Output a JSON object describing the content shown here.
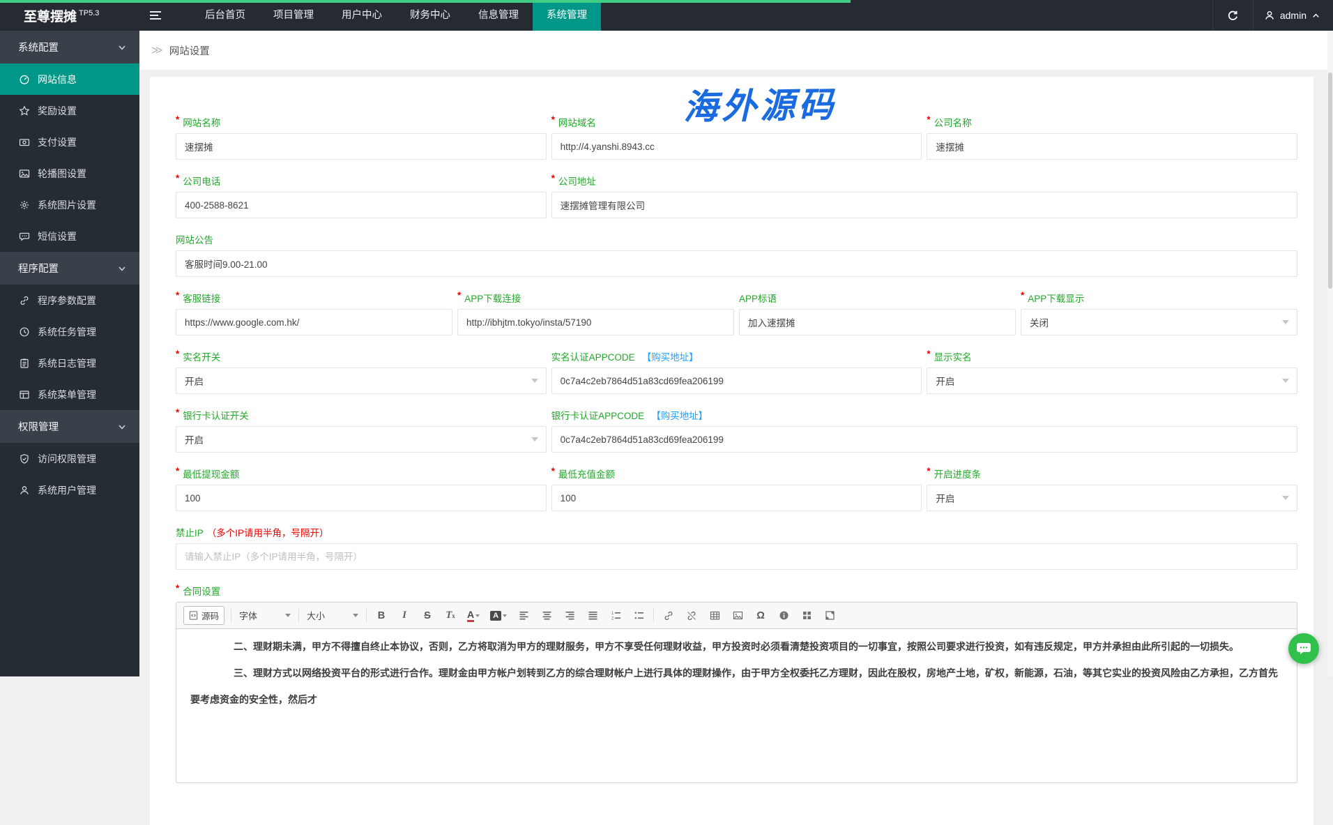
{
  "navbar": {
    "logo": "至尊摆摊",
    "logo_badge": "TP5.3",
    "items": [
      {
        "label": "后台首页"
      },
      {
        "label": "项目管理"
      },
      {
        "label": "用户中心"
      },
      {
        "label": "财务中心"
      },
      {
        "label": "信息管理"
      },
      {
        "label": "系统管理",
        "active": true
      }
    ],
    "user": "admin"
  },
  "sidebar": {
    "groups": [
      {
        "header": "系统配置",
        "items": [
          {
            "label": "网站信息",
            "icon": "dashboard-icon",
            "active": true
          },
          {
            "label": "奖励设置",
            "icon": "star-icon"
          },
          {
            "label": "支付设置",
            "icon": "money-icon"
          },
          {
            "label": "轮播图设置",
            "icon": "carousel-image-icon"
          },
          {
            "label": "系统图片设置",
            "icon": "gear-icon"
          },
          {
            "label": "短信设置",
            "icon": "sms-icon"
          }
        ]
      },
      {
        "header": "程序配置",
        "items": [
          {
            "label": "程序参数配置",
            "icon": "link-icon"
          },
          {
            "label": "系统任务管理",
            "icon": "clock-icon"
          },
          {
            "label": "系统日志管理",
            "icon": "log-icon"
          },
          {
            "label": "系统菜单管理",
            "icon": "window-icon"
          }
        ]
      },
      {
        "header": "权限管理",
        "items": [
          {
            "label": "访问权限管理",
            "icon": "shield-check-icon"
          },
          {
            "label": "系统用户管理",
            "icon": "user-icon"
          }
        ]
      }
    ]
  },
  "breadcrumb": "网站设置",
  "watermark": "海外源码",
  "form": {
    "site_name": {
      "label": "网站名称",
      "required": true,
      "value": "速摆摊"
    },
    "site_domain": {
      "label": "网站域名",
      "required": true,
      "value": "http://4.yanshi.8943.cc"
    },
    "company_name": {
      "label": "公司名称",
      "required": true,
      "value": "速摆摊"
    },
    "company_phone": {
      "label": "公司电话",
      "required": true,
      "value": "400-2588-8621"
    },
    "company_address": {
      "label": "公司地址",
      "required": true,
      "value": "速摆摊管理有限公司"
    },
    "site_notice": {
      "label": "网站公告",
      "value": "客服时间9.00-21.00"
    },
    "service_link": {
      "label": "客服链接",
      "required": true,
      "value": "https://www.google.com.hk/"
    },
    "app_download_link": {
      "label": "APP下载连接",
      "required": true,
      "value": "http://ibhjtm.tokyo/insta/57190"
    },
    "app_slogan": {
      "label": "APP标语",
      "value": "加入速摆摊"
    },
    "app_download_show": {
      "label": "APP下载显示",
      "required": true,
      "value": "关闭"
    },
    "realname_switch": {
      "label": "实名开关",
      "required": true,
      "value": "开启"
    },
    "realname_appcode": {
      "label": "实名认证APPCODE",
      "link": "【购买地址】",
      "value": "0c7a4c2eb7864d51a83cd69fea206199"
    },
    "realname_show": {
      "label": "显示实名",
      "required": true,
      "value": "开启"
    },
    "bankcard_switch": {
      "label": "银行卡认证开关",
      "required": true,
      "value": "开启"
    },
    "bankcard_appcode": {
      "label": "银行卡认证APPCODE",
      "link": "【购买地址】",
      "value": "0c7a4c2eb7864d51a83cd69fea206199"
    },
    "min_withdraw": {
      "label": "最低提现金额",
      "required": true,
      "value": "100"
    },
    "min_recharge": {
      "label": "最低充值金额",
      "required": true,
      "value": "100"
    },
    "progress_bar": {
      "label": "开启进度条",
      "required": true,
      "value": "开启"
    },
    "forbidden_ip": {
      "label": "禁止IP",
      "label_note": "（多个IP请用半角，号隔开）",
      "placeholder": "请输入禁止IP（多个IP请用半角，号隔开）"
    },
    "contract": {
      "label": "合同设置",
      "required": true
    }
  },
  "editor": {
    "toolbar": {
      "source": "源码",
      "font": "字体",
      "size": "大小"
    },
    "paragraphs": [
      "二、理财期未满，甲方不得擅自终止本协议，否则，乙方将取消为甲方的理财服务，甲方不享受任何理财收益，甲方投资时必须看清楚投资项目的一切事宜，按照公司要求进行投资，如有违反规定，甲方并承担由此所引起的一切损失。",
      "三、理财方式以网络投资平台的形式进行合作。理财金由甲方帐户划转到乙方的综合理财帐户上进行具体的理财操作，由于甲方全权委托乙方理财，因此在股权，房地产土地，矿权，新能源，石油，等其它实业的投资风险由乙方承担，乙方首先要考虑资金的安全性，然后才"
    ]
  },
  "colors": {
    "accent_teal": "#009688",
    "progress_green": "#40cd86",
    "label_green": "#22a82a",
    "link_blue": "#1e9fff",
    "required_red": "#ee0000",
    "chat_green": "#2fc14c",
    "topbar_dark": "#262b33"
  }
}
